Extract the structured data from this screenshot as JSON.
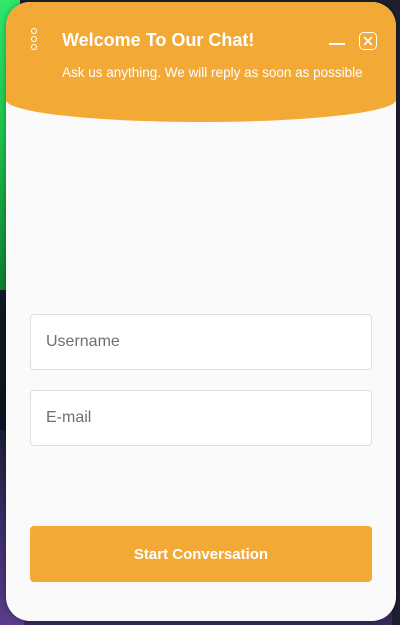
{
  "header": {
    "title": "Welcome To Our Chat!",
    "subtitle": "Ask us anything. We will reply as soon as possible",
    "icons": {
      "menu": "vertical-dots-icon",
      "minimize": "minimize-icon",
      "close": "close-icon"
    }
  },
  "form": {
    "username_placeholder": "Username",
    "username_value": "",
    "email_placeholder": "E-mail",
    "email_value": "",
    "submit_label": "Start Conversation"
  },
  "colors": {
    "accent": "#f2a935",
    "panel_background": "#fafafa",
    "field_border": "#dedede"
  }
}
